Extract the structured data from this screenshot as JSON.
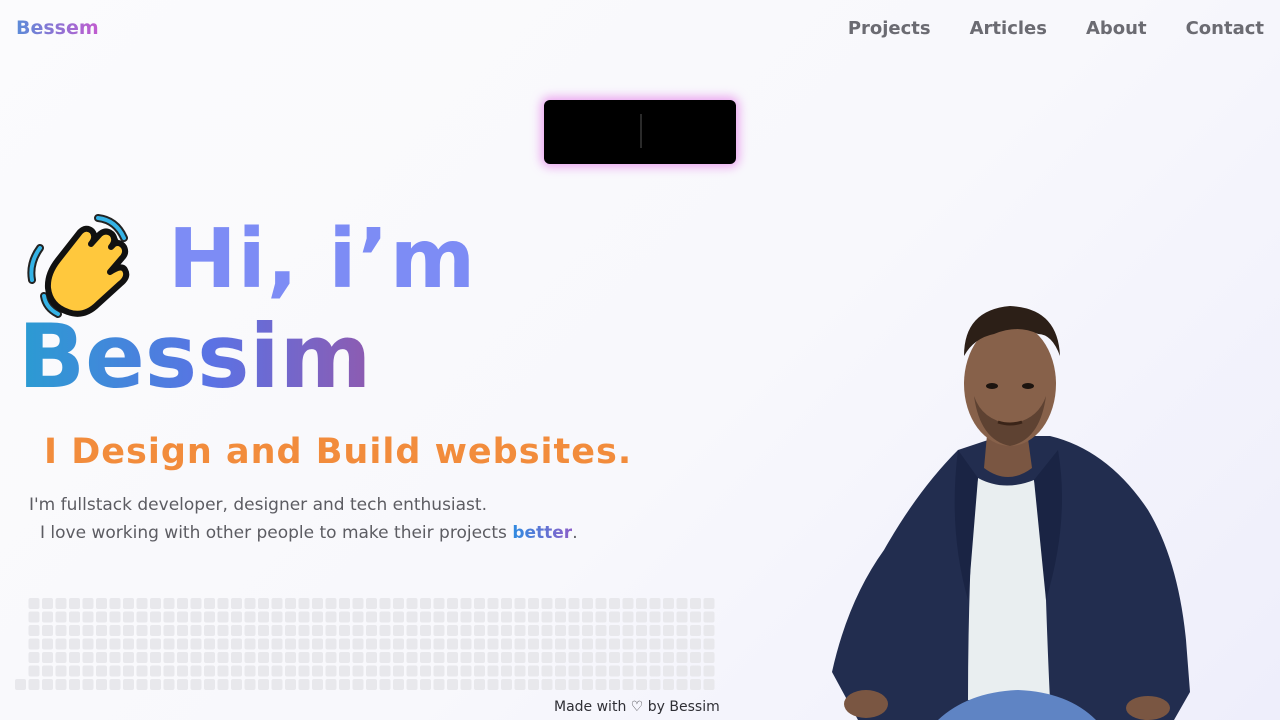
{
  "brand": "Bessem",
  "nav": [
    "Projects",
    "Articles",
    "About",
    "Contact"
  ],
  "hero": {
    "greeting": "Hi, i’m",
    "name": "Bessim",
    "tagline": "I Design and Build websites.",
    "desc_line1": "I'm fullstack developer, designer and tech enthusiast.",
    "desc_line2_prefix": "I love working with other people to make their projects ",
    "desc_line2_highlight": "better",
    "desc_line2_suffix": "."
  },
  "footer": "Made with ♡ by Bessim",
  "icons": {
    "wave": "waving-hand-icon"
  },
  "colors": {
    "greeting": "#7d8cf5",
    "tagline": "#f28c3c",
    "nav_text": "#6b6b72",
    "grid_cell": "#e8e8ec"
  }
}
